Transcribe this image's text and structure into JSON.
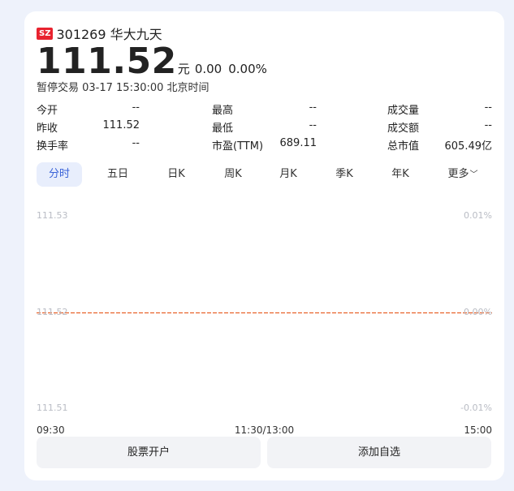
{
  "stock": {
    "market": "SZ",
    "code_name": "301269 华大九天",
    "price": "111.52",
    "unit": "元",
    "change": "0.00",
    "change_pct": "0.00%",
    "status": "暂停交易 03-17 15:30:00 北京时间"
  },
  "stats": [
    [
      {
        "label": "今开",
        "value": "--"
      },
      {
        "label": "最高",
        "value": "--"
      },
      {
        "label": "成交量",
        "value": "--"
      }
    ],
    [
      {
        "label": "昨收",
        "value": "111.52"
      },
      {
        "label": "最低",
        "value": "--"
      },
      {
        "label": "成交额",
        "value": "--"
      }
    ],
    [
      {
        "label": "换手率",
        "value": "--"
      },
      {
        "label": "市盈(TTM)",
        "value": "689.11"
      },
      {
        "label": "总市值",
        "value": "605.49亿"
      }
    ]
  ],
  "tabs": [
    "分时",
    "五日",
    "日K",
    "周K",
    "月K",
    "季K",
    "年K",
    "更多"
  ],
  "active_tab": "分时",
  "more_icon": "chevron-down-icon",
  "chart_data": {
    "type": "line",
    "x": [
      "09:30",
      "11:30/13:00",
      "15:00"
    ],
    "y_left_ticks": [
      "111.53",
      "111.52",
      "111.51"
    ],
    "y_right_ticks": [
      "0.01%",
      "0.00%",
      "-0.01%"
    ],
    "ylim": [
      111.51,
      111.53
    ],
    "reference_price": 111.52,
    "series": [
      {
        "values": []
      }
    ],
    "reference_line_color": "#e8622a",
    "grid": false
  },
  "buttons": {
    "open_account": "股票开户",
    "add_watchlist": "添加自选"
  },
  "colors": {
    "accent": "#3a63d8",
    "market_badge": "#e8232f",
    "reference_line": "#e8622a"
  }
}
